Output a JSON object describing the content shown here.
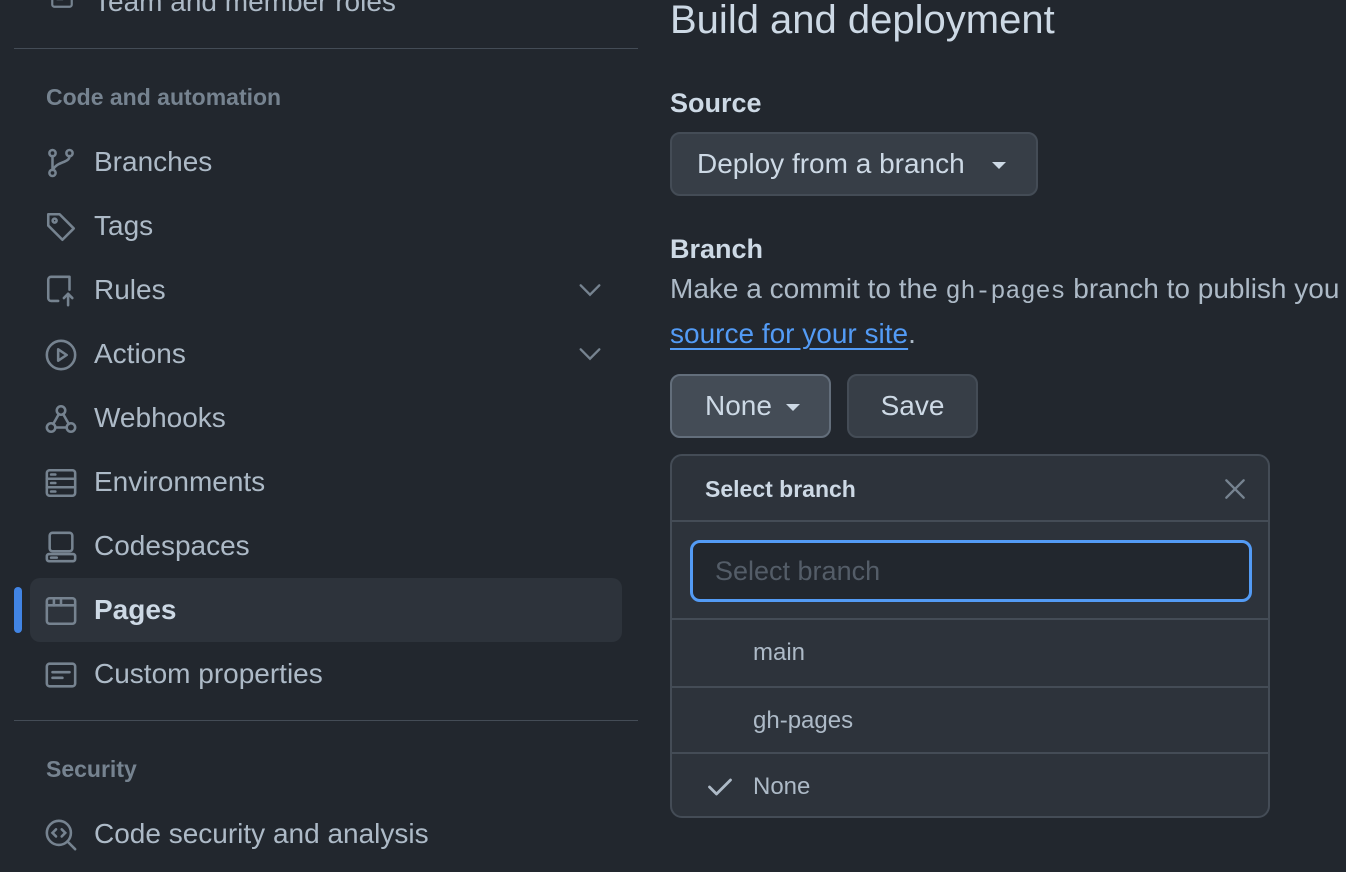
{
  "sidebar": {
    "top_partial_item": {
      "label": "Team and member roles",
      "icon": "people-icon"
    },
    "section_code": "Code and automation",
    "items": [
      {
        "label": "Branches",
        "icon": "git-branch-icon"
      },
      {
        "label": "Tags",
        "icon": "tag-icon"
      },
      {
        "label": "Rules",
        "icon": "repo-push-icon",
        "expandable": true
      },
      {
        "label": "Actions",
        "icon": "play-icon",
        "expandable": true
      },
      {
        "label": "Webhooks",
        "icon": "webhook-icon"
      },
      {
        "label": "Environments",
        "icon": "server-icon"
      },
      {
        "label": "Codespaces",
        "icon": "codespaces-icon"
      },
      {
        "label": "Pages",
        "icon": "browser-icon",
        "selected": true
      },
      {
        "label": "Custom properties",
        "icon": "note-icon"
      }
    ],
    "section_security": "Security",
    "security_items": [
      {
        "label": "Code security and analysis",
        "icon": "codescan-icon"
      }
    ]
  },
  "main": {
    "heading": "Build and deployment",
    "source": {
      "label": "Source",
      "dropdown_value": "Deploy from a branch"
    },
    "branch": {
      "label": "Branch",
      "desc_prefix": "Make a commit to the ",
      "desc_code": "gh-pages",
      "desc_suffix": " branch to publish you",
      "desc_link": "source for your site",
      "desc_end": ".",
      "branch_button": "None",
      "save_button": "Save"
    },
    "select_menu": {
      "title": "Select branch",
      "filter_placeholder": "Select branch",
      "filter_value": "",
      "options": [
        "main",
        "gh-pages",
        "None"
      ],
      "selected": "None"
    }
  },
  "colors": {
    "background": "#22272e",
    "accent": "#539bf5",
    "selected_bar": "#4184e4"
  }
}
